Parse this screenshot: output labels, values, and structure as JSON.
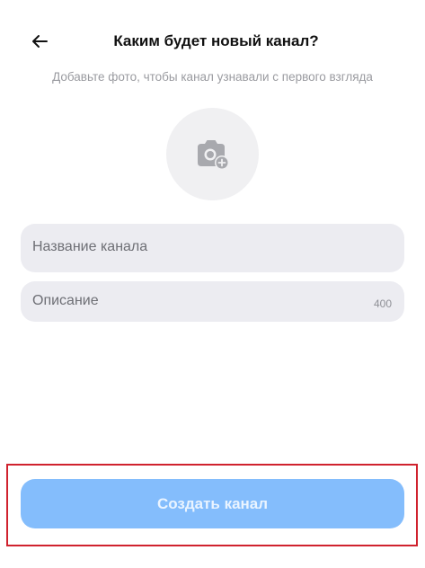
{
  "header": {
    "title": "Каким будет новый канал?",
    "back_icon": "arrow-left-icon"
  },
  "subtitle": "Добавьте фото, чтобы канал узнавали с первого взгляда",
  "avatar_picker": {
    "icon": "camera-add-icon"
  },
  "form": {
    "name_field": {
      "placeholder": "Название канала",
      "value": ""
    },
    "description_field": {
      "placeholder": "Описание",
      "value": "",
      "char_limit": "400"
    }
  },
  "actions": {
    "create_label": "Создать канал"
  },
  "colors": {
    "button_disabled": "#84bdfc",
    "field_bg": "#ececf1",
    "avatar_bg": "#f0f0f2",
    "highlight_border": "#d0222e"
  }
}
